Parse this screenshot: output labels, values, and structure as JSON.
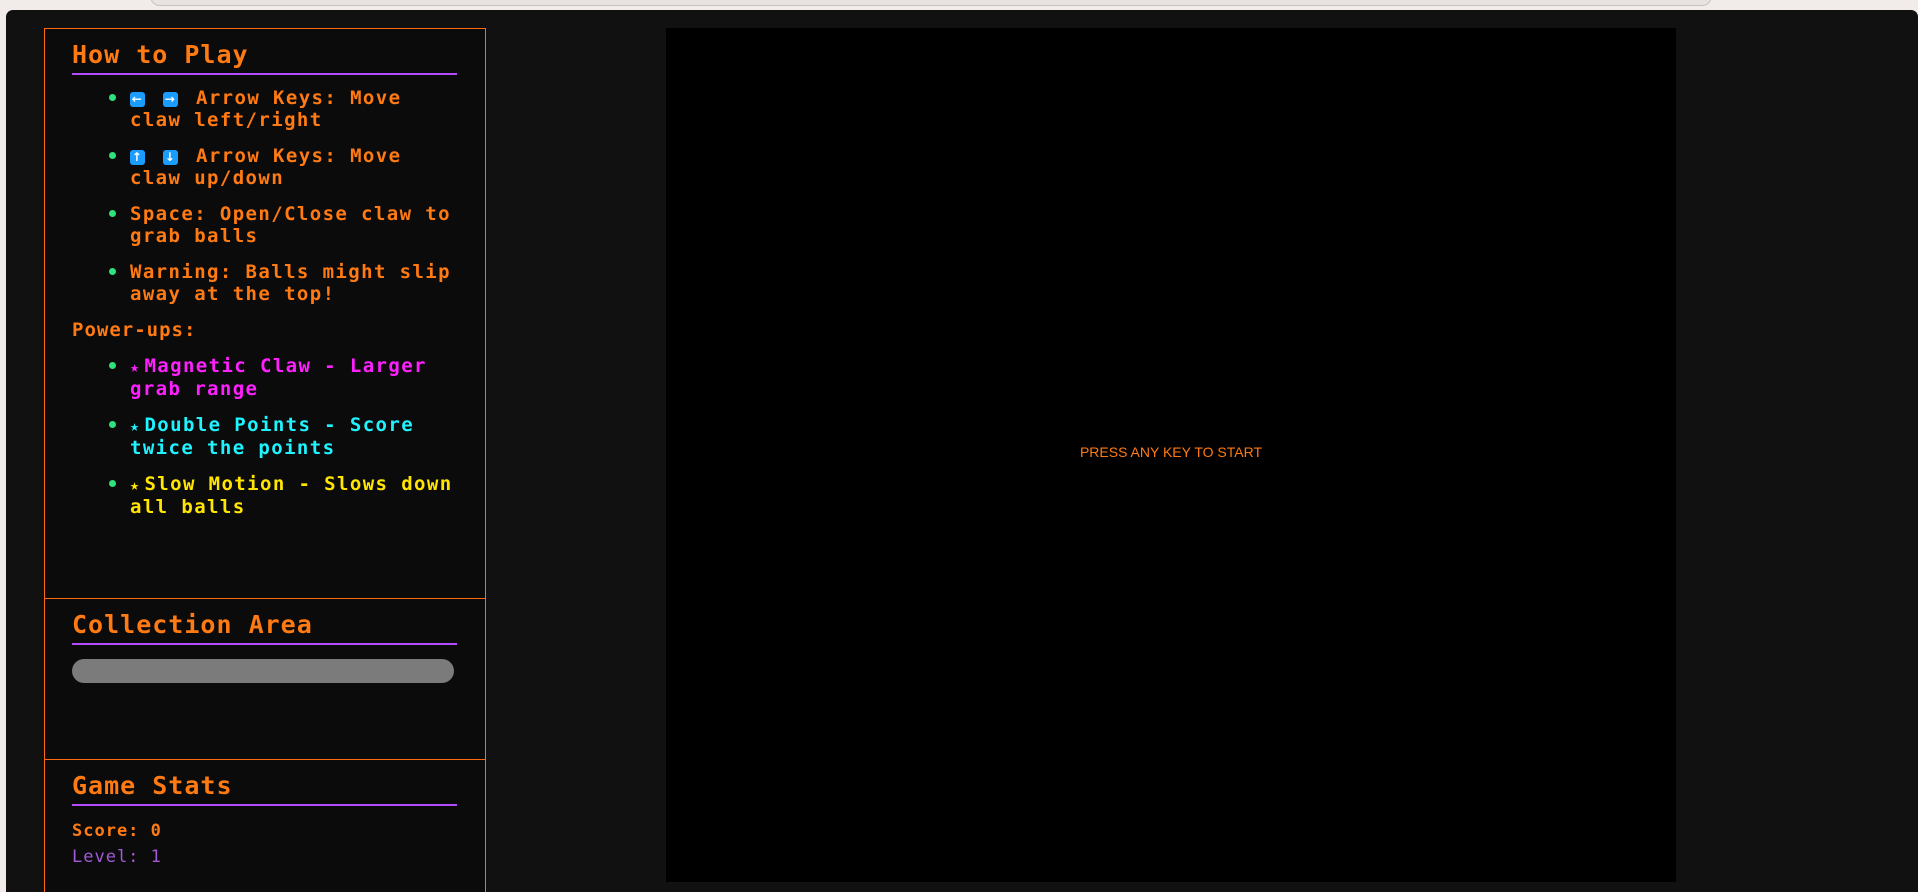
{
  "how_to_play": {
    "title": "How to Play",
    "controls": [
      {
        "keys": [
          "←",
          "→"
        ],
        "text": "Arrow Keys: Move claw left/right"
      },
      {
        "keys": [
          "↑",
          "↓"
        ],
        "text": "Arrow Keys: Move claw up/down"
      },
      {
        "keys": [],
        "text": "Space: Open/Close claw to grab balls"
      },
      {
        "keys": [],
        "text": "Warning: Balls might slip away at the top!"
      }
    ],
    "powerups_label": "Power-ups:",
    "powerups": [
      {
        "star": "★",
        "text": "Magnetic Claw - Larger grab range",
        "color": "#ff20ff"
      },
      {
        "star": "★",
        "text": "Double Points - Score twice the points",
        "color": "#1ff3ff"
      },
      {
        "star": "★",
        "text": "Slow Motion - Slows down all balls",
        "color": "#ffe500"
      }
    ]
  },
  "collection": {
    "title": "Collection Area"
  },
  "stats": {
    "title": "Game Stats",
    "score_label": "Score:",
    "score_value": "0",
    "level_label": "Level:",
    "level_value": "1"
  },
  "game": {
    "start_message": "PRESS ANY KEY TO START"
  },
  "colors": {
    "accent": "#ff7a12",
    "divider": "#b24cff",
    "bullet": "#2ee27c",
    "key": "#1a9dff"
  }
}
